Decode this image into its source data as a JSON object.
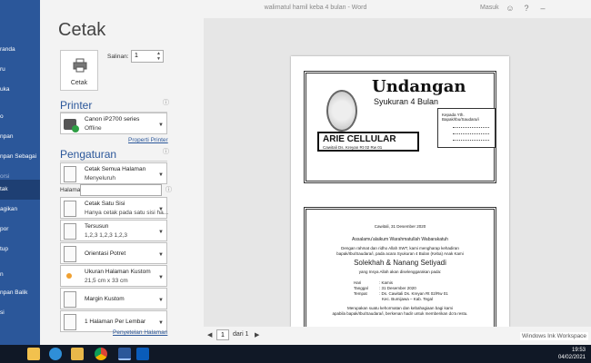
{
  "window": {
    "title": "walimatul hamil keba 4 bulan  -  Word",
    "signin": "Masuk",
    "icons": [
      "smile-icon",
      "help-icon",
      "minimize-icon"
    ]
  },
  "nav": {
    "items": [
      {
        "label": "randa",
        "active": false,
        "dim": false
      },
      {
        "label": "ru",
        "active": false,
        "dim": false
      },
      {
        "label": "uka",
        "active": false,
        "dim": false
      },
      {
        "label": "o",
        "active": false,
        "dim": false
      },
      {
        "label": "npan",
        "active": false,
        "dim": false
      },
      {
        "label": "npan Sebagai",
        "active": false,
        "dim": false
      },
      {
        "label": "orsi",
        "active": false,
        "dim": true
      },
      {
        "label": "tak",
        "active": true,
        "dim": false
      },
      {
        "label": "agikan",
        "active": false,
        "dim": false
      },
      {
        "label": "por",
        "active": false,
        "dim": false
      },
      {
        "label": "tup",
        "active": false,
        "dim": false
      },
      {
        "label": "n",
        "active": false,
        "dim": false
      },
      {
        "label": "npan Balik",
        "active": false,
        "dim": false
      },
      {
        "label": "si",
        "active": false,
        "dim": false
      }
    ]
  },
  "print": {
    "heading": "Cetak",
    "button_label": "Cetak",
    "copies_label": "Salinan:",
    "copies_value": "1",
    "printer_heading": "Printer",
    "printer_name": "Canon iP2700 series",
    "printer_status": "Offline",
    "printer_props_link": "Properti Printer",
    "settings_heading": "Pengaturan",
    "pages_label": "Halaman:",
    "page_setup_link": "Penyetelan Halaman",
    "settings": [
      {
        "line1": "Cetak Semua Halaman",
        "line2": "Menyeluruh"
      },
      {
        "line1": "Cetak Satu Sisi",
        "line2": "Hanya cetak pada satu sisi ha..."
      },
      {
        "line1": "Tersusun",
        "line2": "1,2,3    1,2,3    1,2,3"
      },
      {
        "line1": "Orientasi Potret",
        "line2": ""
      },
      {
        "line1": "Ukuran Halaman Kustom",
        "line2": "21,5 cm x 33 cm"
      },
      {
        "line1": "Margin Kustom",
        "line2": ""
      },
      {
        "line1": "1 Halaman Per Lembar",
        "line2": ""
      }
    ]
  },
  "preview": {
    "card1": {
      "title": "Undangan",
      "subtitle": "Syukuran 4 Bulan",
      "addr_line1": "Kepada Yth.",
      "addr_line2": "Bapak/Ibu/Saudara/i",
      "store_name": "ARIE CELLULAR",
      "store_address": "Cawitali Ds. Kreyan Rt 02 Rw 01"
    },
    "card2": {
      "place_date": "Cawitali, 31 Desember 2020",
      "greeting": "Assalamu'alaikum Warahmatullah Wabarakatuh",
      "body1": "Dengan rahmat dan ridho Allah SWT, kami mengharap kehadiran",
      "body2": "bapak/Ibu/Saudara/i, pada acara Syukuran 4 Bulan (Keba) Anak Kami",
      "couple": "Solekhah & Nanang Setiyadi",
      "body3": "yang Insya Allah akan diselenggarakan pada:",
      "hari_label": "Hari",
      "hari_value": ": Kamis",
      "tanggal_label": "Tanggal",
      "tanggal_value": ": 31 Desember 2020",
      "tempat_label": "Tempat",
      "tempat_value": ": Ds. Cawitali Ds. Kreyan Rt 02/Rw 01",
      "kec": "Kec. Bumijawa – Kab. Tegal",
      "closing1": "Merupakan suatu kehormatan dan kebahagiaan bagi kami",
      "closing2": "apabila bapak/Ibu/Saudara/i, berkenan hadir untuk memberikan do'a restu."
    }
  },
  "pagenav": {
    "current": "1",
    "of": "dari 1",
    "watermark": "Windows Ink Workspace"
  },
  "taskbar": {
    "time": "19:53",
    "date": "04/02/2021"
  }
}
